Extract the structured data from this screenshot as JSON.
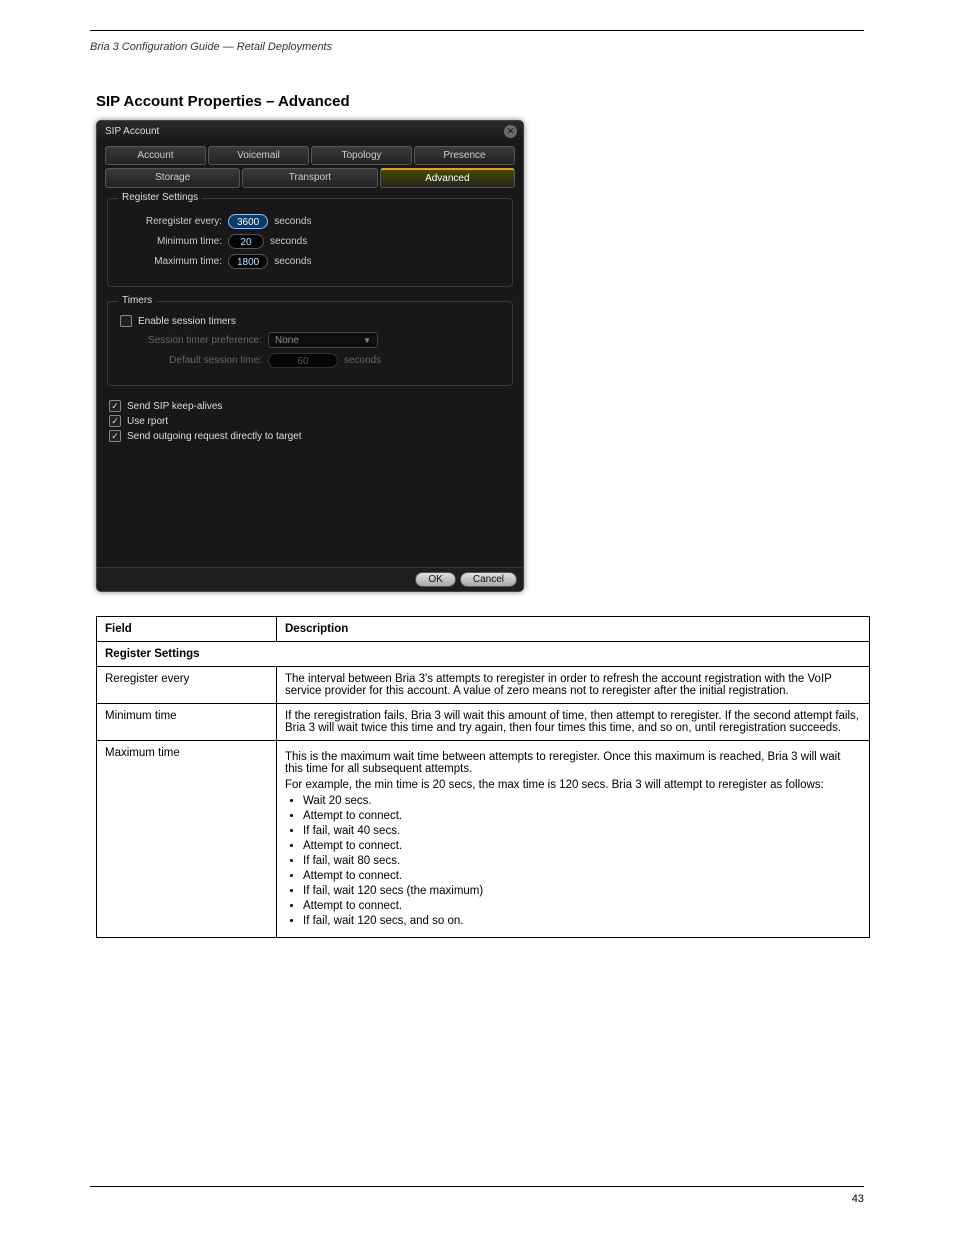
{
  "header": {
    "left": "Bria 3 Configuration Guide — Retail Deployments",
    "right": ""
  },
  "section_title": "SIP Account Properties – Advanced",
  "dialog": {
    "title": "SIP Account",
    "tabs_row1": [
      "Account",
      "Voicemail",
      "Topology",
      "Presence"
    ],
    "tabs_row2": [
      "Storage",
      "Transport",
      "Advanced"
    ],
    "selected_tab": "Advanced",
    "register_settings": {
      "legend": "Register Settings",
      "reregister_label": "Reregister every:",
      "reregister_value": "3600",
      "min_label": "Minimum time:",
      "min_value": "20",
      "max_label": "Maximum time:",
      "max_value": "1800",
      "seconds": "seconds"
    },
    "timers": {
      "legend": "Timers",
      "enable_label": "Enable session timers",
      "enable_checked": false,
      "pref_label": "Session timer preference:",
      "pref_value": "None",
      "default_label": "Default session time:",
      "default_value": "60",
      "seconds": "seconds"
    },
    "checks": {
      "keepalives": {
        "label": "Send SIP keep-alives",
        "checked": true
      },
      "rport": {
        "label": "Use rport",
        "checked": true
      },
      "direct": {
        "label": "Send outgoing request directly to target",
        "checked": true
      }
    },
    "buttons": {
      "ok": "OK",
      "cancel": "Cancel"
    }
  },
  "table": {
    "headers": [
      "Field",
      "Description"
    ],
    "section": "Register Settings",
    "rows": [
      {
        "field": "Reregister every",
        "desc": "The interval between Bria 3's attempts to reregister in order to refresh the account registration with the VoIP service provider for this account. A value of zero means not to reregister after the initial registration."
      },
      {
        "field": "Minimum time",
        "desc": "If the reregistration fails, Bria 3 will wait this amount of time, then attempt to reregister. If the second attempt fails, Bria 3 will wait twice this time and try again, then four times this time, and so on, until reregistration succeeds."
      },
      {
        "field": "Maximum time",
        "desc_blocks": [
          {
            "type": "p",
            "text": "This is the maximum wait time between attempts to reregister. Once this maximum is reached, Bria 3 will wait this time for all subsequent attempts."
          },
          {
            "type": "p",
            "text": "For example, the min time is 20 secs, the max time is 120 secs. Bria 3 will attempt to reregister as follows:"
          },
          {
            "type": "ul",
            "items": [
              "Wait 20 secs.",
              "Attempt to connect.",
              "If fail, wait 40 secs.",
              "Attempt to connect.",
              "If fail, wait 80 secs.",
              "Attempt to connect.",
              "If fail, wait 120 secs (the maximum)",
              "Attempt to connect.",
              "If fail, wait 120 secs, and so on."
            ]
          }
        ]
      }
    ]
  },
  "footer": {
    "left": "",
    "right": "43"
  }
}
